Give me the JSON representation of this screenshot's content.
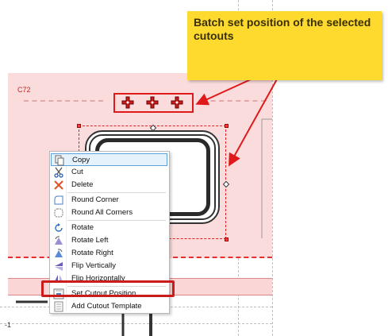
{
  "callout": {
    "text": "Batch set position of the selected cutouts",
    "color": "#fed92e"
  },
  "drawing": {
    "cutout_label": "C72",
    "edge_label": "-1",
    "accent": "#e01a1a",
    "pink": "#fbdcdc"
  },
  "context_menu": {
    "items": [
      {
        "label": "Copy",
        "icon": "copy-icon"
      },
      {
        "label": "Cut",
        "icon": "scissors-icon"
      },
      {
        "label": "Delete",
        "icon": "delete-x-icon"
      },
      {
        "label": "Round Corner",
        "icon": "round-corner-icon"
      },
      {
        "label": "Round All Corners",
        "icon": "round-all-corners-icon"
      },
      {
        "label": "Rotate",
        "icon": "rotate-icon"
      },
      {
        "label": "Rotate Left",
        "icon": "rotate-left-icon"
      },
      {
        "label": "Rotate Right",
        "icon": "rotate-right-icon"
      },
      {
        "label": "Flip Vertically",
        "icon": "flip-vertical-icon"
      },
      {
        "label": "Flip Horizontally",
        "icon": "flip-horizontal-icon"
      },
      {
        "label": "Set Cutout Position",
        "icon": "set-position-icon"
      },
      {
        "label": "Add Cutout Template",
        "icon": "template-icon"
      }
    ]
  }
}
